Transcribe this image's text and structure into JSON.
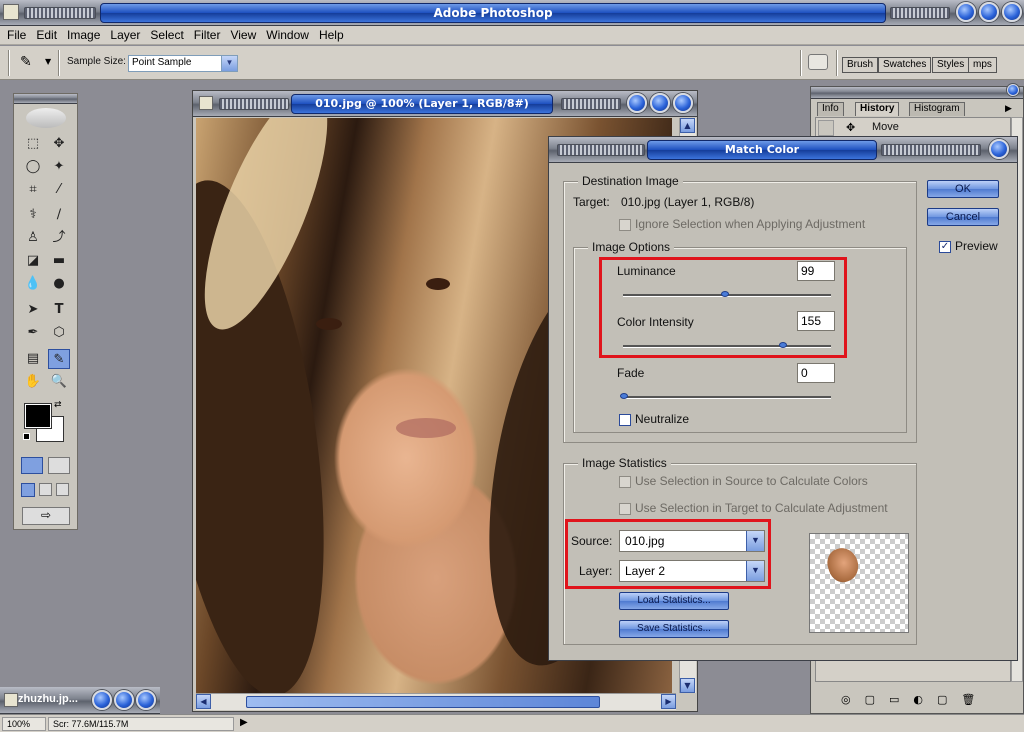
{
  "app": {
    "title": "Adobe Photoshop"
  },
  "menu": [
    "File",
    "Edit",
    "Image",
    "Layer",
    "Select",
    "Filter",
    "View",
    "Window",
    "Help"
  ],
  "options_bar": {
    "sample_size_label": "Sample Size:",
    "sample_size_value": "Point Sample",
    "well_tabs": [
      "Brush",
      "Swatches",
      "Styles",
      "mps"
    ]
  },
  "document": {
    "title": "010.jpg @ 100% (Layer 1, RGB/8#)",
    "minimized_title": "zhuzhu.jp..."
  },
  "history_palette": {
    "tabs": [
      "Info",
      "History",
      "Histogram"
    ],
    "active_tab": "History",
    "items": [
      "Move"
    ]
  },
  "dialog": {
    "title": "Match Color",
    "ok": "OK",
    "cancel": "Cancel",
    "preview_label": "Preview",
    "preview_checked": true,
    "destination": {
      "group_title": "Destination Image",
      "target_label": "Target:",
      "target_value": "010.jpg (Layer 1, RGB/8)",
      "ignore_selection": "Ignore Selection when Applying Adjustment"
    },
    "image_options": {
      "group_title": "Image Options",
      "luminance_label": "Luminance",
      "luminance": "99",
      "color_intensity_label": "Color Intensity",
      "color_intensity": "155",
      "fade_label": "Fade",
      "fade": "0",
      "neutralize": "Neutralize"
    },
    "statistics": {
      "group_title": "Image Statistics",
      "use_sel_source": "Use Selection in Source to Calculate Colors",
      "use_sel_target": "Use Selection in Target to Calculate Adjustment",
      "source_label": "Source:",
      "source_value": "010.jpg",
      "layer_label": "Layer:",
      "layer_value": "Layer 2",
      "load": "Load Statistics...",
      "save": "Save Statistics..."
    }
  },
  "status": {
    "zoom": "100%",
    "scratch": "Scr: 77.6M/115.7M"
  },
  "colors": {
    "accent_blue": "#1d4fbf",
    "highlight_red": "#e0141c"
  }
}
